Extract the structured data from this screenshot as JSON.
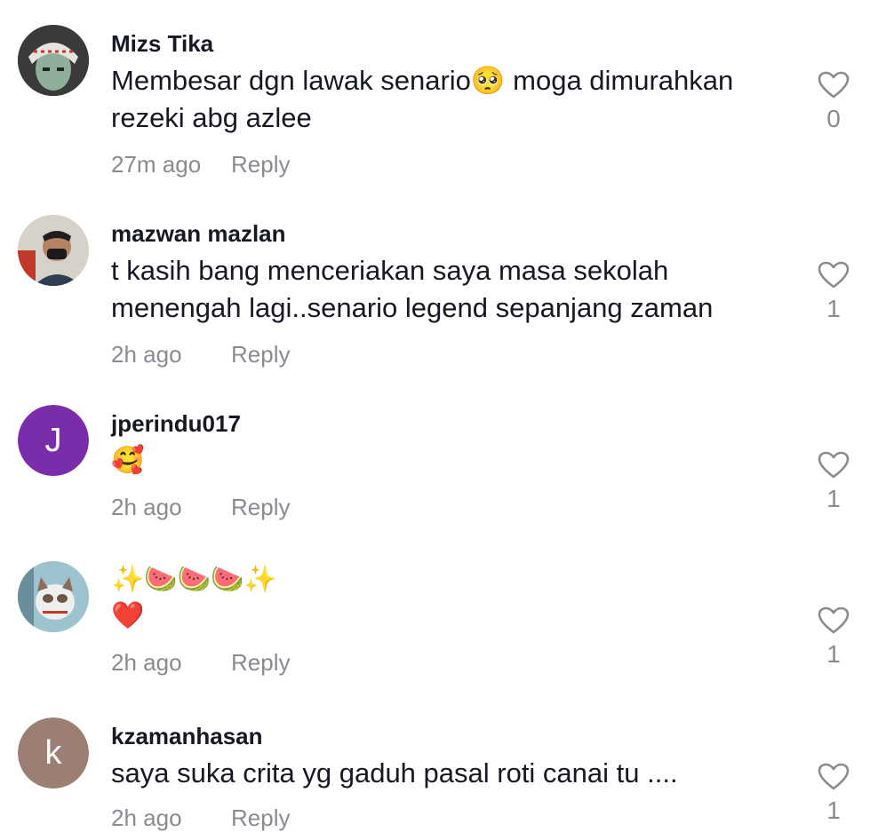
{
  "comments": [
    {
      "username": "Mizs Tika",
      "text": "Membesar dgn lawak senario🥺 moga dimurahkan rezeki abg azlee",
      "time": "27m ago",
      "reply": "Reply",
      "likes": "0"
    },
    {
      "username": "mazwan mazlan",
      "text": "t kasih bang menceriakan saya masa sekolah menengah lagi..senario legend sepanjang zaman",
      "time": "2h ago",
      "reply": "Reply",
      "likes": "1"
    },
    {
      "username": "jperindu017",
      "avatar_letter": "J",
      "avatar_color": "#7a2dab",
      "text": "🥰",
      "time": "2h ago",
      "reply": "Reply",
      "likes": "1"
    },
    {
      "username": "",
      "text_line1": "✨🍉🍉🍉✨",
      "text_line2": "❤️",
      "time": "2h ago",
      "reply": "Reply",
      "likes": "1"
    },
    {
      "username": "kzamanhasan",
      "avatar_letter": "k",
      "avatar_color": "#9a7f72",
      "text": "saya suka crita yg gaduh pasal roti canai tu ....",
      "time": "2h ago",
      "reply": "Reply",
      "likes": "1"
    }
  ],
  "icons": {
    "like": "heart-outline-icon"
  }
}
